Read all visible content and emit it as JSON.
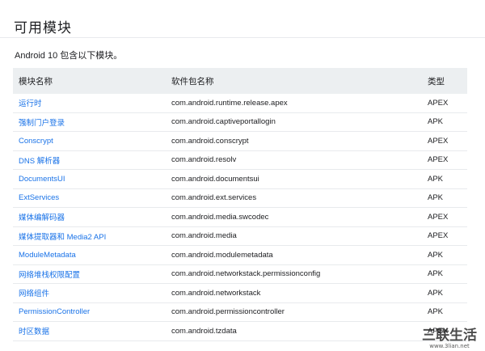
{
  "page": {
    "title": "可用模块",
    "intro": "Android 10 包含以下模块。"
  },
  "table": {
    "headers": [
      "模块名称",
      "软件包名称",
      "类型"
    ],
    "rows": [
      {
        "name": "运行时",
        "package": "com.android.runtime.release.apex",
        "type": "APEX"
      },
      {
        "name": "强制门户登录",
        "package": "com.android.captiveportallogin",
        "type": "APK"
      },
      {
        "name": "Conscrypt",
        "package": "com.android.conscrypt",
        "type": "APEX"
      },
      {
        "name": "DNS 解析器",
        "package": "com.android.resolv",
        "type": "APEX"
      },
      {
        "name": "DocumentsUI",
        "package": "com.android.documentsui",
        "type": "APK"
      },
      {
        "name": "ExtServices",
        "package": "com.android.ext.services",
        "type": "APK"
      },
      {
        "name": "媒体编解码器",
        "package": "com.android.media.swcodec",
        "type": "APEX"
      },
      {
        "name": "媒体提取器和 Media2 API",
        "package": "com.android.media",
        "type": "APEX"
      },
      {
        "name": "ModuleMetadata",
        "package": "com.android.modulemetadata",
        "type": "APK"
      },
      {
        "name": "网络堆栈权限配置",
        "package": "com.android.networkstack.permissionconfig",
        "type": "APK"
      },
      {
        "name": "网络组件",
        "package": "com.android.networkstack",
        "type": "APK"
      },
      {
        "name": "PermissionController",
        "package": "com.android.permissioncontroller",
        "type": "APK"
      },
      {
        "name": "时区数据",
        "package": "com.android.tzdata",
        "type": "APEX"
      }
    ]
  },
  "watermark": {
    "text": "三联生活",
    "subtext": "www.3lian.net"
  }
}
